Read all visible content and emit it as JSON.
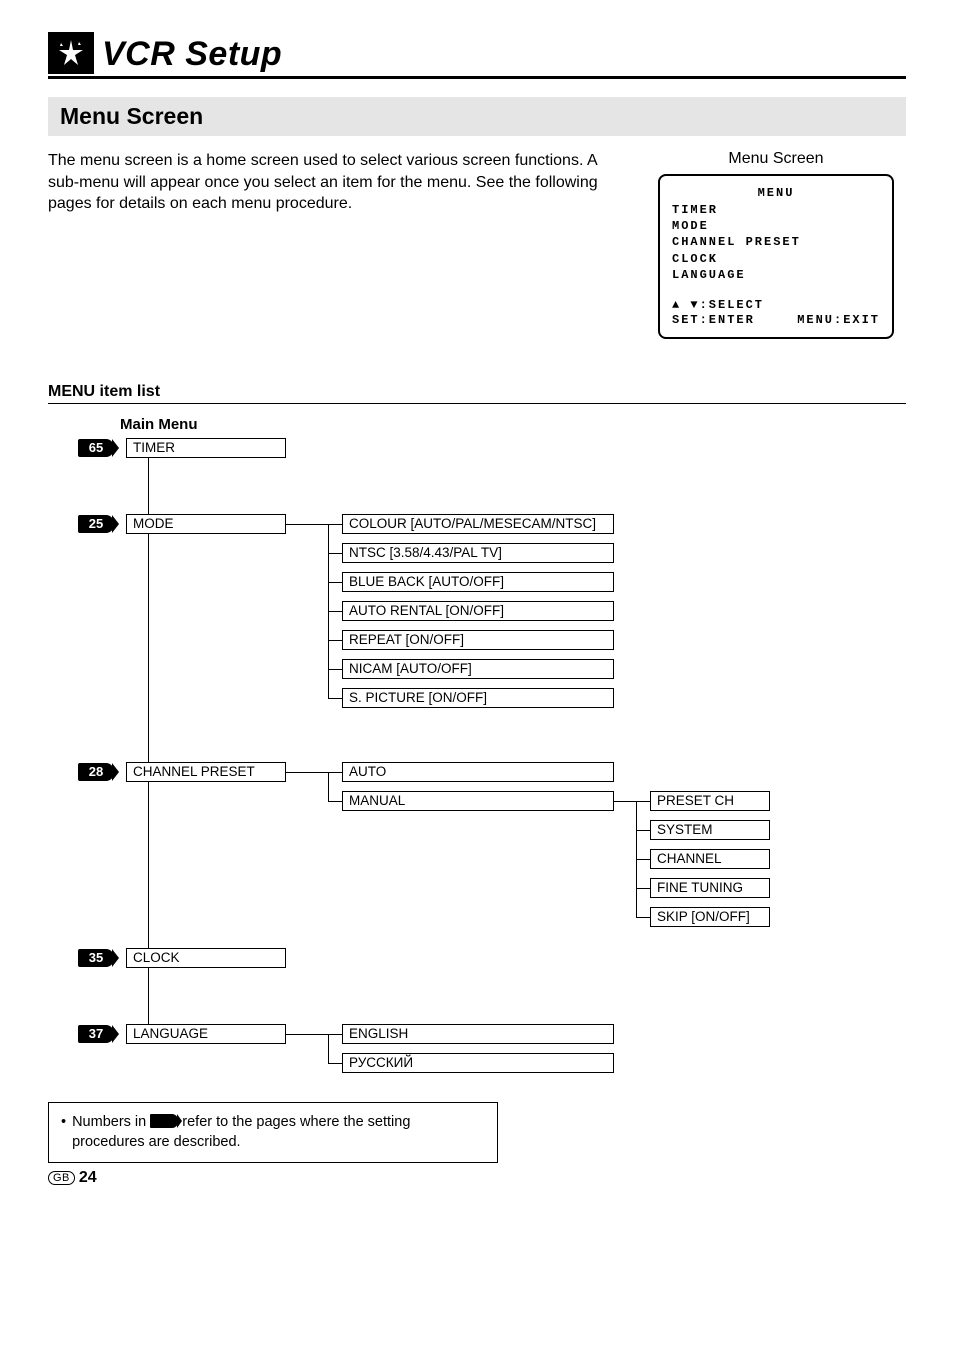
{
  "header": {
    "title": "VCR Setup"
  },
  "section": {
    "title": "Menu Screen"
  },
  "intro": "The menu screen is a home screen used to select various screen functions. A sub-menu will appear once you select an item for the menu. See the following pages for details on each menu procedure.",
  "osd": {
    "caption": "Menu Screen",
    "title": "MENU",
    "items": [
      "TIMER",
      "MODE",
      "CHANNEL PRESET",
      "CLOCK",
      "LANGUAGE"
    ],
    "select_hint": "▲ ▼:SELECT",
    "set_hint": "SET:ENTER",
    "exit_hint": "MENU:EXIT"
  },
  "menu_list": {
    "heading": "MENU item list",
    "main_label": "Main Menu",
    "timer": {
      "page": "65",
      "label": "TIMER"
    },
    "mode": {
      "page": "25",
      "label": "MODE",
      "subs": [
        "COLOUR [AUTO/PAL/MESECAM/NTSC]",
        "NTSC [3.58/4.43/PAL TV]",
        "BLUE BACK [AUTO/OFF]",
        "AUTO RENTAL [ON/OFF]",
        "REPEAT [ON/OFF]",
        "NICAM [AUTO/OFF]",
        "S. PICTURE [ON/OFF]"
      ]
    },
    "channel": {
      "page": "28",
      "label": "CHANNEL PRESET",
      "subs": [
        "AUTO",
        "MANUAL"
      ],
      "manual_subs": [
        "PRESET CH",
        "SYSTEM",
        "CHANNEL",
        "FINE TUNING",
        "SKIP [ON/OFF]"
      ]
    },
    "clock": {
      "page": "35",
      "label": "CLOCK"
    },
    "language": {
      "page": "37",
      "label": "LANGUAGE",
      "subs": [
        "ENGLISH",
        "РУССКИЙ"
      ]
    }
  },
  "note": {
    "pre": "Numbers in ",
    "post": " refer to the pages where the setting procedures are described."
  },
  "footer": {
    "region": "GB",
    "page": "24"
  }
}
